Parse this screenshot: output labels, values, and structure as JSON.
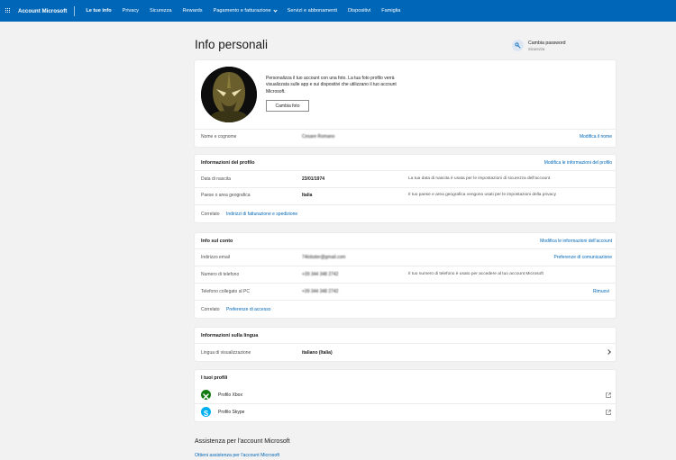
{
  "topbar": {
    "brand": "Account Microsoft",
    "nav": [
      {
        "label": "Le tue info"
      },
      {
        "label": "Privacy"
      },
      {
        "label": "Sicurezza"
      },
      {
        "label": "Rewards"
      },
      {
        "label": "Pagamento e fatturazione"
      },
      {
        "label": "Servizi e abbonamenti"
      },
      {
        "label": "Dispositivi"
      },
      {
        "label": "Famiglia"
      }
    ]
  },
  "page": {
    "title": "Info personali",
    "change_password": {
      "label": "Cambia password",
      "sub": "Sicurezza"
    }
  },
  "profile_card": {
    "intro": "Personalizza il tuo account con una foto. La tua foto profilo verrà visualizzata sulle app e sui dispositivi che utilizzano il tuo account Microsoft.",
    "change_photo": "Cambia foto",
    "name_label": "Nome e cognome",
    "name_value": "Cesare Romano",
    "edit_name": "Modifica il nome"
  },
  "profile_info": {
    "heading": "Informazioni del profilo",
    "edit": "Modifica le informazioni del profilo",
    "birth_label": "Data di nascita",
    "birth_value": "23/01/1974",
    "birth_desc": "La tua data di nascita è usata per le impostazioni di sicurezza dell'account",
    "country_label": "Paese o area geografica",
    "country_value": "Italia",
    "country_desc": "Il tuo paese e area geografica vengono usati per le impostazioni della privacy",
    "related": "Correlato",
    "related_link": "Indirizzi di fatturazione e spedizione"
  },
  "account_info": {
    "heading": "Info sul conto",
    "edit": "Modifica le informazioni dell'account",
    "email_label": "Indirizzo email",
    "email_value": "74lobster@gmail.com",
    "email_link": "Preferenze di comunicazione",
    "phone_label": "Numero di telefono",
    "phone_value": "+39 344 348 2742",
    "phone_desc": "Il tuo numero di telefono è usato per accedere al tuo account Microsoft",
    "pc_phone_label": "Telefono collegato al PC",
    "pc_phone_value": "+39 344 348 2742",
    "remove": "Rimuovi",
    "related": "Correlato",
    "related_link": "Preferenze di accesso"
  },
  "language": {
    "heading": "Informazioni sulla lingua",
    "label": "Lingua di visualizzazione",
    "value": "italiano (Italia)"
  },
  "profiles": {
    "heading": "I tuoi profili",
    "xbox": "Profilo Xbox",
    "skype": "Profilo Skype"
  },
  "footer": {
    "title": "Assistenza per l'account Microsoft",
    "link": "Ottieni assistenza per l'account Microsoft"
  },
  "colors": {
    "brand_blue": "#0067b8",
    "xbox_green": "#107c10",
    "skype_blue": "#00aff0"
  }
}
